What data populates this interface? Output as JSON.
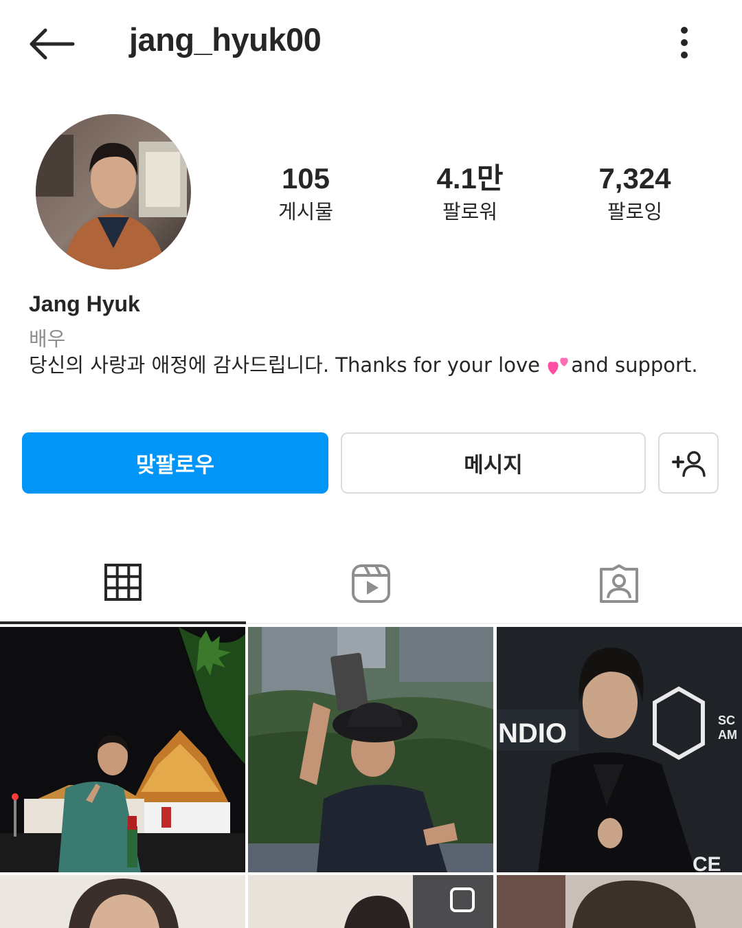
{
  "header": {
    "username": "jang_hyuk00",
    "back_icon": "arrow-left-icon",
    "more_icon": "more-vertical-icon"
  },
  "stats": [
    {
      "value": "105",
      "label": "게시물"
    },
    {
      "value": "4.1만",
      "label": "팔로워"
    },
    {
      "value": "7,324",
      "label": "팔로잉"
    }
  ],
  "profile": {
    "full_name": "Jang Hyuk",
    "category": "배우",
    "bio_before_emoji": "당신의 사랑과 애정에 감사드립니다. Thanks for your love ",
    "bio_emoji": "two-hearts-icon",
    "bio_after_emoji": "and support."
  },
  "actions": {
    "follow_back_label": "맞팔로우",
    "message_label": "메시지",
    "suggest_icon": "add-person-icon"
  },
  "tabs": [
    {
      "icon": "grid-icon",
      "active": true
    },
    {
      "icon": "reels-icon",
      "active": false
    },
    {
      "icon": "tagged-icon",
      "active": false
    }
  ],
  "colors": {
    "primary_blue": "#0095f6",
    "text": "#262626",
    "secondary_text": "#8e8e8e",
    "border": "#dbdbdb",
    "heart_pink": "#ff4fa3"
  }
}
